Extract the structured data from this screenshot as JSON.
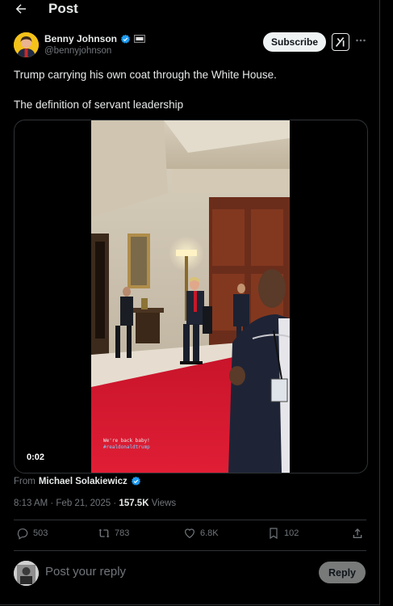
{
  "header": {
    "title": "Post"
  },
  "post": {
    "author_name": "Benny Johnson",
    "author_handle": "@bennyjohnson",
    "subscribe_label": "Subscribe",
    "text_line1": "Trump carrying his own coat through the White House.",
    "text_line2": "The definition of servant leadership",
    "video_timestamp": "0:02",
    "video_caption_line1": "We're back baby!",
    "video_caption_line2": "#realdonaldtrump",
    "from_label": "From",
    "from_name": "Michael Solakiewicz",
    "date": "8:13 AM · Feb 21, 2025 · ",
    "views_count": "157.5K",
    "views_label": "Views"
  },
  "actions": {
    "replies": "503",
    "reposts": "783",
    "likes": "6.8K",
    "bookmarks": "102"
  },
  "reply": {
    "placeholder": "Post your reply",
    "button_label": "Reply"
  },
  "colors": {
    "background": "#000000",
    "verified": "#1d9bf0",
    "muted": "#71767b",
    "carpet": "#d8192f"
  },
  "icons": [
    "back-arrow-icon",
    "verified-badge-icon",
    "affiliate-badge-icon",
    "grok-icon",
    "more-icon",
    "reply-icon",
    "repost-icon",
    "like-icon",
    "bookmark-icon",
    "share-icon"
  ]
}
